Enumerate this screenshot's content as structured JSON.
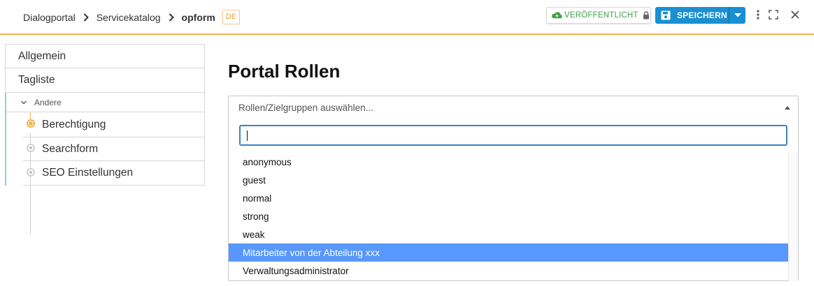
{
  "breadcrumb": {
    "items": [
      "Dialogportal",
      "Servicekatalog"
    ],
    "current": "opform",
    "lang": "DE"
  },
  "toolbar": {
    "publish_label": "VERÖFFENTLICHT",
    "save_label": "SPEICHERN"
  },
  "sidebar": {
    "items": [
      "Allgemein",
      "Tagliste"
    ],
    "group": {
      "label": "Andere",
      "items": [
        "Berechtigung",
        "Searchform",
        "SEO Einstellungen"
      ],
      "active_index": 0
    }
  },
  "main": {
    "title": "Portal Rollen",
    "select": {
      "placeholder": "Rollen/Zielgruppen auswählen...",
      "search_value": "",
      "options": [
        "anonymous",
        "guest",
        "normal",
        "strong",
        "weak",
        "Mitarbeiter von der Abteilung xxx",
        "Verwaltungsadministrator"
      ],
      "highlighted_index": 5
    }
  },
  "colors": {
    "accent": "#f0b14a",
    "primary": "#1a8fd1",
    "published": "#43a047",
    "highlight": "#5897fb",
    "group_border": "#8ecde8"
  },
  "icons": {
    "breadcrumb_separator": "chevron-right-icon",
    "publish": "cloud-upload-icon",
    "lock": "lock-icon",
    "save": "floppy-disk-icon",
    "save_dropdown": "caret-down-icon",
    "more": "more-vertical-icon",
    "fullscreen": "fullscreen-icon",
    "close": "close-icon",
    "group_toggle": "chevron-down-icon"
  }
}
